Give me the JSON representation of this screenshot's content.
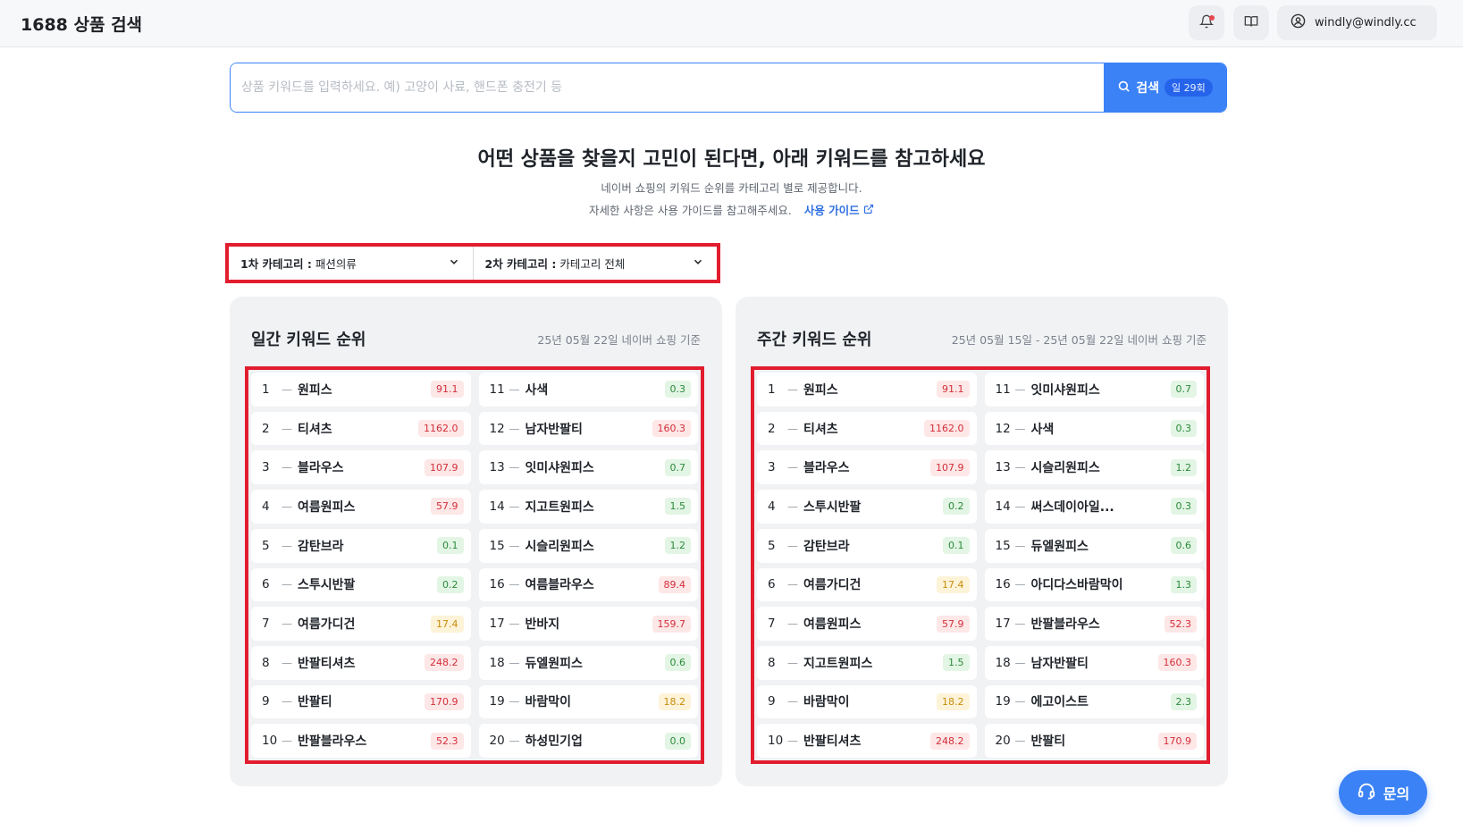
{
  "header": {
    "app_title": "1688 상품 검색",
    "user_email": "windly@windly.cc"
  },
  "search": {
    "placeholder": "상품 키워드를 입력하세요. 예) 고양이 사료, 핸드폰 충전기 등",
    "button_label": "검색",
    "quota": "일 29회"
  },
  "intro": {
    "headline": "어떤 상품을 찾을지 고민이 된다면, 아래 키워드를 참고하세요",
    "line1": "네이버 쇼핑의 키워드 순위를 카테고리 별로 제공합니다.",
    "line2": "자세한 사항은 사용 가이드를 참고해주세요.",
    "guide_link": "사용 가이드"
  },
  "categories": {
    "first_label": "1차 카테고리 :",
    "first_value": "패션의류",
    "second_label": "2차 카테고리 :",
    "second_value": "카테고리 전체"
  },
  "daily": {
    "title": "일간 키워드 순위",
    "date": "25년 05월 22일 네이버 쇼핑 기준",
    "items": [
      {
        "rank": "1",
        "keyword": "원피스",
        "score": "91.1",
        "color": "red"
      },
      {
        "rank": "2",
        "keyword": "티셔츠",
        "score": "1162.0",
        "color": "red"
      },
      {
        "rank": "3",
        "keyword": "블라우스",
        "score": "107.9",
        "color": "red"
      },
      {
        "rank": "4",
        "keyword": "여름원피스",
        "score": "57.9",
        "color": "red"
      },
      {
        "rank": "5",
        "keyword": "감탄브라",
        "score": "0.1",
        "color": "green"
      },
      {
        "rank": "6",
        "keyword": "스투시반팔",
        "score": "0.2",
        "color": "green"
      },
      {
        "rank": "7",
        "keyword": "여름가디건",
        "score": "17.4",
        "color": "yellow"
      },
      {
        "rank": "8",
        "keyword": "반팔티셔츠",
        "score": "248.2",
        "color": "red"
      },
      {
        "rank": "9",
        "keyword": "반팔티",
        "score": "170.9",
        "color": "red"
      },
      {
        "rank": "10",
        "keyword": "반팔블라우스",
        "score": "52.3",
        "color": "red"
      },
      {
        "rank": "11",
        "keyword": "사색",
        "score": "0.3",
        "color": "green"
      },
      {
        "rank": "12",
        "keyword": "남자반팔티",
        "score": "160.3",
        "color": "red"
      },
      {
        "rank": "13",
        "keyword": "잇미샤원피스",
        "score": "0.7",
        "color": "green"
      },
      {
        "rank": "14",
        "keyword": "지고트원피스",
        "score": "1.5",
        "color": "green"
      },
      {
        "rank": "15",
        "keyword": "시슬리원피스",
        "score": "1.2",
        "color": "green"
      },
      {
        "rank": "16",
        "keyword": "여름블라우스",
        "score": "89.4",
        "color": "red"
      },
      {
        "rank": "17",
        "keyword": "반바지",
        "score": "159.7",
        "color": "red"
      },
      {
        "rank": "18",
        "keyword": "듀엘원피스",
        "score": "0.6",
        "color": "green"
      },
      {
        "rank": "19",
        "keyword": "바람막이",
        "score": "18.2",
        "color": "yellow"
      },
      {
        "rank": "20",
        "keyword": "하성민기업",
        "score": "0.0",
        "color": "green"
      }
    ]
  },
  "weekly": {
    "title": "주간 키워드 순위",
    "date": "25년 05월 15일 - 25년 05월 22일 네이버 쇼핑 기준",
    "items": [
      {
        "rank": "1",
        "keyword": "원피스",
        "score": "91.1",
        "color": "red"
      },
      {
        "rank": "2",
        "keyword": "티셔츠",
        "score": "1162.0",
        "color": "red"
      },
      {
        "rank": "3",
        "keyword": "블라우스",
        "score": "107.9",
        "color": "red"
      },
      {
        "rank": "4",
        "keyword": "스투시반팔",
        "score": "0.2",
        "color": "green"
      },
      {
        "rank": "5",
        "keyword": "감탄브라",
        "score": "0.1",
        "color": "green"
      },
      {
        "rank": "6",
        "keyword": "여름가디건",
        "score": "17.4",
        "color": "yellow"
      },
      {
        "rank": "7",
        "keyword": "여름원피스",
        "score": "57.9",
        "color": "red"
      },
      {
        "rank": "8",
        "keyword": "지고트원피스",
        "score": "1.5",
        "color": "green"
      },
      {
        "rank": "9",
        "keyword": "바람막이",
        "score": "18.2",
        "color": "yellow"
      },
      {
        "rank": "10",
        "keyword": "반팔티셔츠",
        "score": "248.2",
        "color": "red"
      },
      {
        "rank": "11",
        "keyword": "잇미샤원피스",
        "score": "0.7",
        "color": "green"
      },
      {
        "rank": "12",
        "keyword": "사색",
        "score": "0.3",
        "color": "green"
      },
      {
        "rank": "13",
        "keyword": "시슬리원피스",
        "score": "1.2",
        "color": "green"
      },
      {
        "rank": "14",
        "keyword": "써스데이아일...",
        "score": "0.3",
        "color": "green"
      },
      {
        "rank": "15",
        "keyword": "듀엘원피스",
        "score": "0.6",
        "color": "green"
      },
      {
        "rank": "16",
        "keyword": "아디다스바람막이",
        "score": "1.3",
        "color": "green"
      },
      {
        "rank": "17",
        "keyword": "반팔블라우스",
        "score": "52.3",
        "color": "red"
      },
      {
        "rank": "18",
        "keyword": "남자반팔티",
        "score": "160.3",
        "color": "red"
      },
      {
        "rank": "19",
        "keyword": "에고이스트",
        "score": "2.3",
        "color": "green"
      },
      {
        "rank": "20",
        "keyword": "반팔티",
        "score": "170.9",
        "color": "red"
      }
    ]
  },
  "help": {
    "label": "문의"
  },
  "icons": {
    "bell": "bell-icon",
    "book": "book-icon",
    "user": "user-circle-icon",
    "search": "search-icon",
    "external": "external-link-icon",
    "chevron": "chevron-down-icon",
    "headset": "headset-icon"
  },
  "colors": {
    "accent": "#3b82f6",
    "highlight_frame": "#e11d2e",
    "badge_red": "#d32f3a",
    "badge_green": "#2c8a3c",
    "badge_yellow": "#c88c0a"
  }
}
